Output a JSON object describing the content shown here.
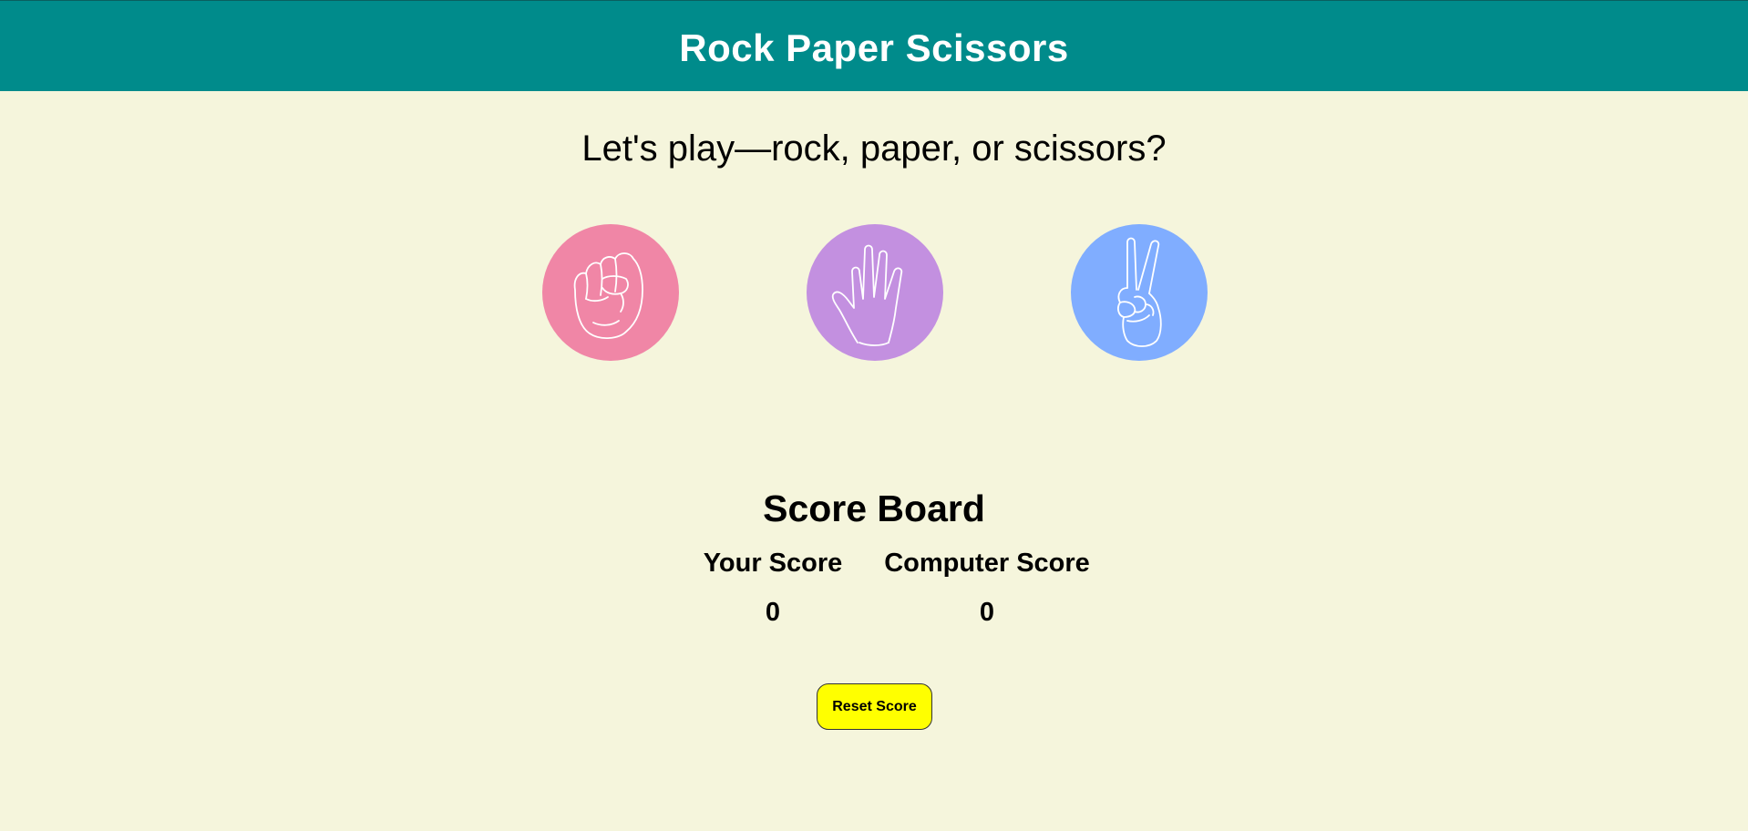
{
  "header": {
    "title": "Rock Paper Scissors"
  },
  "prompt": "Let's play—rock, paper, or scissors?",
  "choices": [
    {
      "id": "rock",
      "icon": "fist-icon",
      "color": "#f086a6"
    },
    {
      "id": "paper",
      "icon": "open-hand-icon",
      "color": "#c390e0"
    },
    {
      "id": "scissors",
      "icon": "peace-hand-icon",
      "color": "#80adff"
    }
  ],
  "scoreboard": {
    "title": "Score Board",
    "user_label": "Your Score",
    "user_score": "0",
    "computer_label": "Computer Score",
    "computer_score": "0"
  },
  "reset_label": "Reset Score",
  "colors": {
    "header_bg": "#008b8b",
    "page_bg": "#f5f5dc",
    "reset_bg": "#ffff00"
  }
}
